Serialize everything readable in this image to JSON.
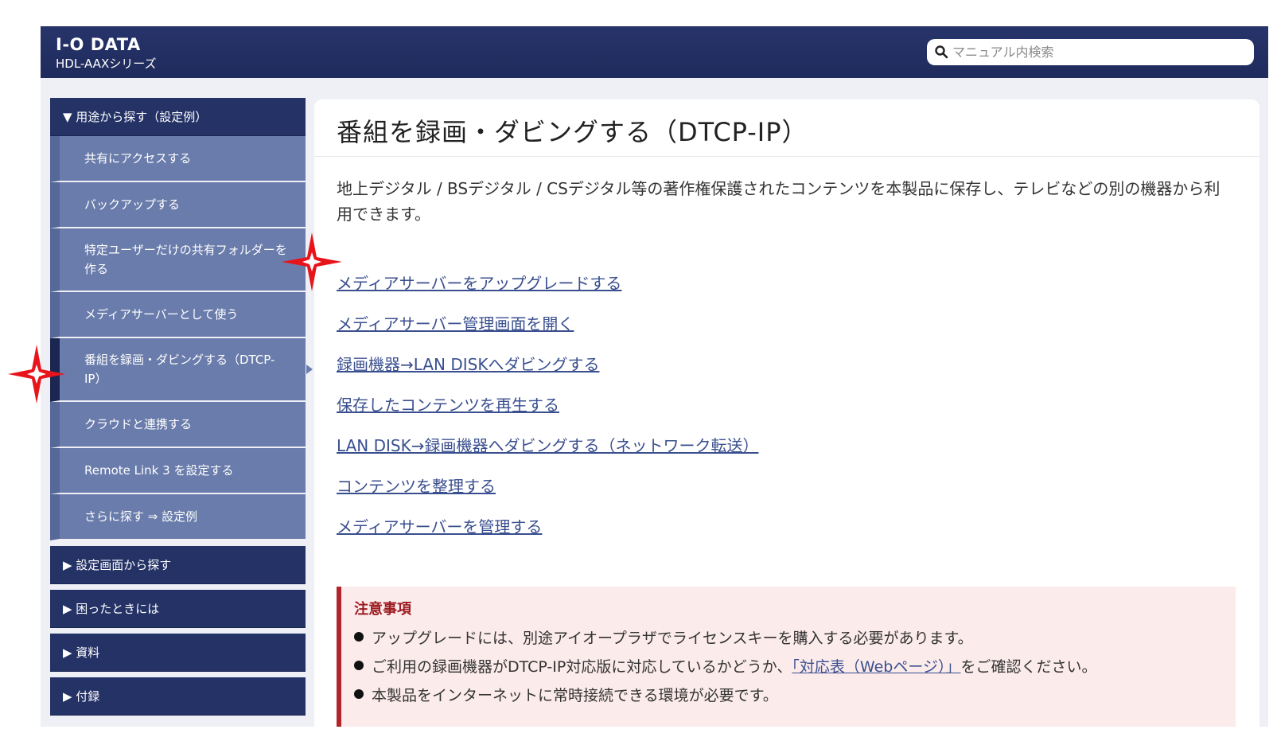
{
  "header": {
    "logo": "I-O DATA",
    "series": "HDL-AAXシリーズ",
    "search_placeholder": "マニュアル内検索"
  },
  "sidebar": {
    "expanded_section": "▼ 用途から探す（設定例）",
    "items": [
      {
        "label": "共有にアクセスする"
      },
      {
        "label": "バックアップする"
      },
      {
        "label": "特定ユーザーだけの共有フォルダーを作る"
      },
      {
        "label": "メディアサーバーとして使う"
      },
      {
        "label": "番組を録画・ダビングする（DTCP-IP）",
        "active": true
      },
      {
        "label": "クラウドと連携する"
      },
      {
        "label": "Remote Link 3 を設定する"
      },
      {
        "label": "さらに探す ⇒ 設定例"
      }
    ],
    "collapsed_sections": [
      {
        "label": "▶ 設定画面から探す"
      },
      {
        "label": "▶ 困ったときには"
      },
      {
        "label": "▶ 資料"
      },
      {
        "label": "▶ 付録"
      }
    ]
  },
  "main": {
    "title": "番組を録画・ダビングする（DTCP-IP）",
    "intro": "地上デジタル / BSデジタル / CSデジタル等の著作権保護されたコンテンツを本製品に保存し、テレビなどの別の機器から利用できます。",
    "links": [
      "メディアサーバーをアップグレードする",
      "メディアサーバー管理画面を開く",
      "録画機器→LAN DISKへダビングする",
      "保存したコンテンツを再生する",
      "LAN DISK→録画機器へダビングする（ネットワーク転送）",
      "コンテンツを整理する",
      "メディアサーバーを管理する"
    ],
    "notice": {
      "title": "注意事項",
      "item1": "アップグレードには、別途アイオープラザでライセンスキーを購入する必要があります。",
      "item2_before": "ご利用の録画機器がDTCP-IP対応版に対応しているかどうか、",
      "item2_link": "「対応表（Webページ）」",
      "item2_after": "をご確認ください。",
      "item3": "本製品をインターネットに常時接続できる環境が必要です。"
    }
  },
  "markers": {
    "icon": "red-four-point-star-icon",
    "color": "#e8141c"
  },
  "colors": {
    "header_bg": "#1f2b5c",
    "sidebar_item_bg": "#6a7cab",
    "sidebar_head_bg": "#243266",
    "link": "#3a4f8f",
    "notice_border": "#b2242a"
  }
}
